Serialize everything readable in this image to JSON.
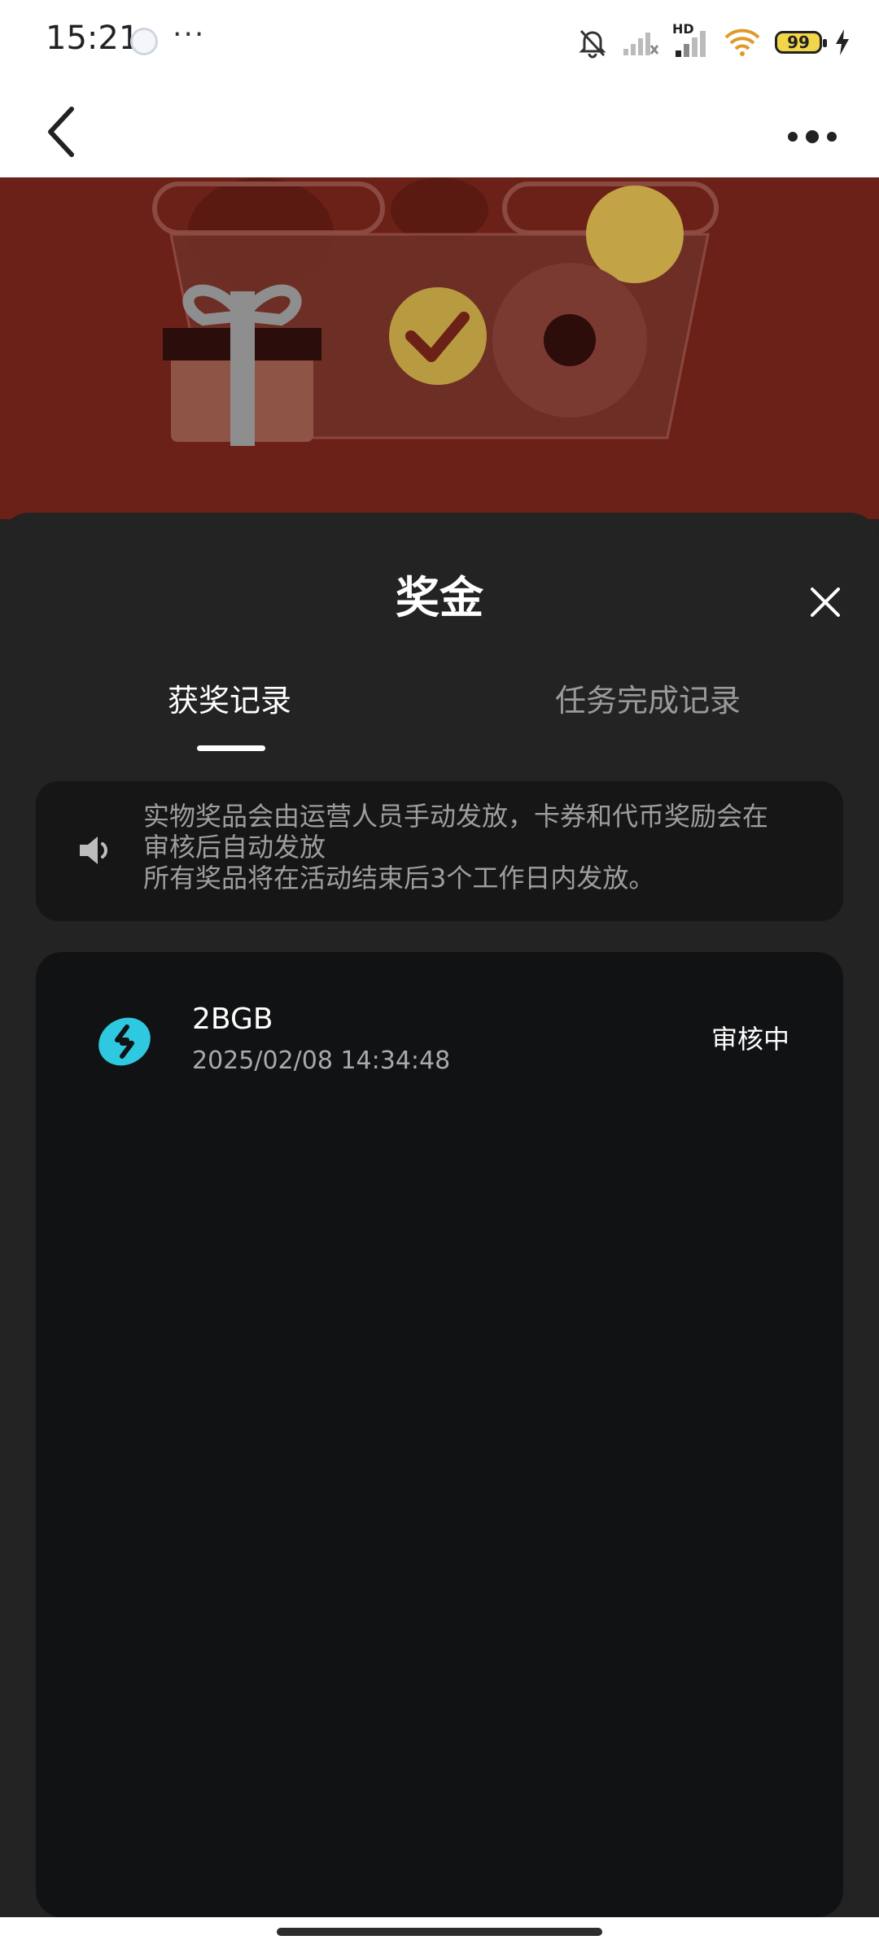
{
  "status_bar": {
    "time": "15:21",
    "more": "···",
    "network_label": "HD",
    "battery": "99"
  },
  "sheet": {
    "title": "奖金",
    "tabs": [
      {
        "label": "获奖记录",
        "active": true
      },
      {
        "label": "任务完成记录",
        "active": false
      }
    ],
    "notice": {
      "text": "实物奖品会由运营人员手动发放，卡券和代币奖励会在\n审核后自动发放\n所有奖品将在活动结束后3个工作日内发放。"
    },
    "records": [
      {
        "name": "2BGB",
        "time": "2025/02/08 14:34:48",
        "status": "审核中",
        "icon": "token-icon"
      }
    ]
  },
  "colors": {
    "hero_background": "#6b2118",
    "sheet_background": "#232323",
    "record_card": "#111214",
    "token_icon": "#2ec8e0"
  }
}
